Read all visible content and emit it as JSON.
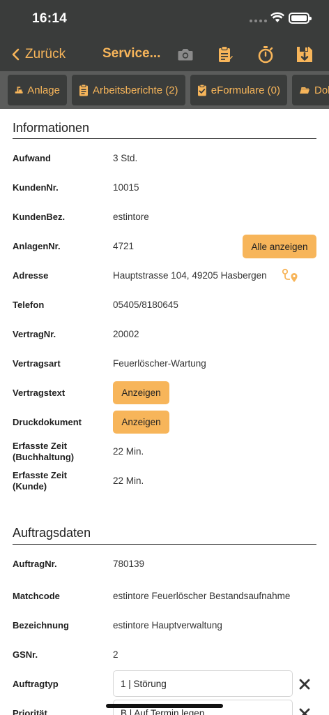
{
  "status_bar": {
    "time": "16:14"
  },
  "nav": {
    "back_label": "Zurück",
    "title": "Service...",
    "icons": [
      "camera-icon",
      "clipboard-icon",
      "stopwatch-icon",
      "save-icon"
    ]
  },
  "tabs": [
    {
      "label": "Anlage",
      "icon": "equipment-icon"
    },
    {
      "label": "Arbeitsberichte (2)",
      "icon": "clipboard-list-icon"
    },
    {
      "label": "eFormulare (0)",
      "icon": "clipboard-check-icon"
    },
    {
      "label": "Dok",
      "icon": "documents-icon"
    }
  ],
  "info": {
    "title": "Informationen",
    "rows": {
      "aufwand": {
        "label": "Aufwand",
        "value": "3 Std."
      },
      "kundennr": {
        "label": "KundenNr.",
        "value": "10015"
      },
      "kundenbez": {
        "label": "KundenBez.",
        "value": "estintore"
      },
      "anlagennr": {
        "label": "AnlagenNr.",
        "value": "4721",
        "button": "Alle anzeigen"
      },
      "adresse": {
        "label": "Adresse",
        "value": "Hauptstrasse 104, 49205 Hasbergen",
        "icon": "route-icon"
      },
      "telefon": {
        "label": "Telefon",
        "value": "05405/8180645"
      },
      "vertragnr": {
        "label": "VertragNr.",
        "value": "20002"
      },
      "vertragsart": {
        "label": "Vertragsart",
        "value": "Feuerlöscher-Wartung"
      },
      "vertragstext": {
        "label": "Vertragstext",
        "button": "Anzeigen"
      },
      "druckdokument": {
        "label": "Druckdokument",
        "button": "Anzeigen"
      },
      "zeit_buchhaltung": {
        "label_1": "Erfasste Zeit",
        "label_2": "(Buchhaltung)",
        "value": "22 Min."
      },
      "zeit_kunde": {
        "label_1": "Erfasste Zeit",
        "label_2": "(Kunde)",
        "value": "22 Min."
      }
    }
  },
  "auftrag": {
    "title": "Auftragsdaten",
    "rows": {
      "auftragnr": {
        "label": "AuftragNr.",
        "value": "780139"
      },
      "matchcode": {
        "label": "Matchcode",
        "value": "estintore Feuerlöscher Bestandsaufnahme"
      },
      "bezeichnung": {
        "label": "Bezeichnung",
        "value": "estintore Hauptverwaltung"
      },
      "gsnr": {
        "label": "GSNr.",
        "value": "2"
      },
      "auftragtyp": {
        "label": "Auftragtyp",
        "value": "1  |  Störung"
      },
      "prioritaet": {
        "label": "Priorität",
        "value": "B  |  Auf Termin legen"
      }
    }
  },
  "colors": {
    "accent": "#f7b55a",
    "bar": "#3a3c3b",
    "tabbar": "#5b5c5b"
  }
}
